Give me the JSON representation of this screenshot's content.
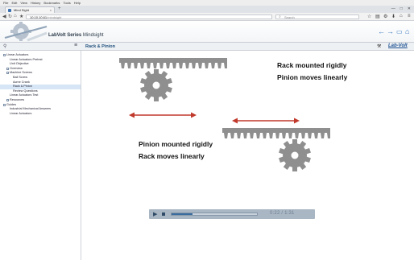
{
  "browser": {
    "menu": [
      "File",
      "Edit",
      "View",
      "History",
      "Bookmarks",
      "Tools",
      "Help"
    ],
    "tab_title": "Mind Sight",
    "tab_close": "×",
    "new_tab": "+",
    "url_host": "10.10.10.61",
    "url_path": "/mindsight",
    "search_placeholder": "Search",
    "window_controls": [
      "—",
      "□",
      "✕"
    ]
  },
  "app": {
    "title_prefix": "LabVolt Series",
    "title_suffix": "Mindsight"
  },
  "subheader": {
    "page_title": "Rack & Pinion",
    "brand": "Lab-Volt"
  },
  "sidebar": {
    "items": [
      {
        "label": "Linear Actuators",
        "level": 0,
        "box": true
      },
      {
        "label": "Linear Actuators Pretest",
        "level": 1
      },
      {
        "label": "Unit Objective",
        "level": 1
      },
      {
        "label": "Overview",
        "level": 1,
        "box": true
      },
      {
        "label": "Machine Screws",
        "level": 1,
        "box": true
      },
      {
        "label": "Ball Screw",
        "level": 2
      },
      {
        "label": "Acme Crank",
        "level": 2
      },
      {
        "label": "Rack & Pinion",
        "level": 2,
        "current": true
      },
      {
        "label": "Review Questions",
        "level": 2
      },
      {
        "label": "Linear Actuators Test",
        "level": 1
      },
      {
        "label": "Resources",
        "level": 1,
        "box": true
      },
      {
        "label": "Guides",
        "level": 0,
        "box": true
      },
      {
        "label": "Industrial Mechanical Answers",
        "level": 1
      },
      {
        "label": "Linear Actuators",
        "level": 1
      }
    ]
  },
  "diagram": {
    "caption_top_line1": "Rack mounted rigidly",
    "caption_top_line2": "Pinion moves linearly",
    "caption_bottom_line1": "Pinion mounted rigidly",
    "caption_bottom_line2": "Rack moves linearly",
    "gear_color": "#8f8f8f",
    "arrow_color": "#c0392b"
  },
  "player": {
    "time": "0:22 / 1:31",
    "progress": 0.242
  }
}
